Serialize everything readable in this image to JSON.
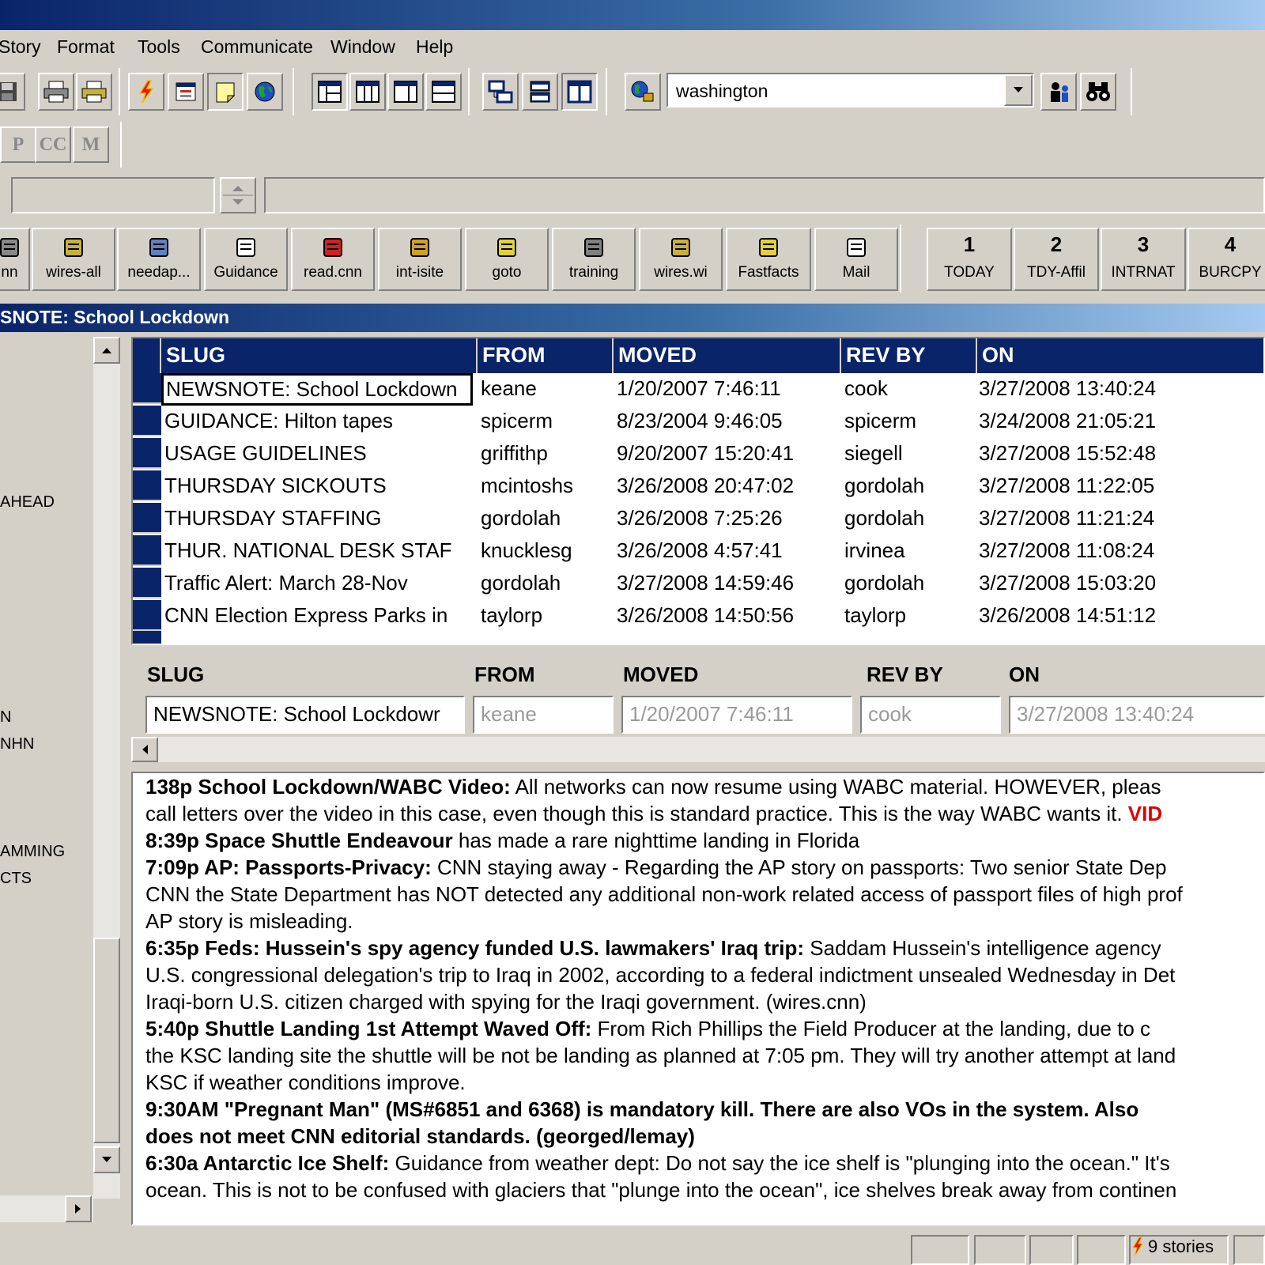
{
  "menu": [
    "Story",
    "Format",
    "Tools",
    "Communicate",
    "Window",
    "Help"
  ],
  "search": {
    "value": "washington"
  },
  "mode_buttons": [
    "P",
    "CC",
    "M"
  ],
  "quick_buttons": [
    {
      "label": "nn"
    },
    {
      "label": "wires-all"
    },
    {
      "label": "needap..."
    },
    {
      "label": "Guidance"
    },
    {
      "label": "read.cnn"
    },
    {
      "label": "int-isite"
    },
    {
      "label": "goto"
    },
    {
      "label": "training"
    },
    {
      "label": "wires.wi"
    },
    {
      "label": "Fastfacts"
    },
    {
      "label": "Mail"
    }
  ],
  "queue_buttons": [
    {
      "num": "1",
      "label": "TODAY"
    },
    {
      "num": "2",
      "label": "TDY-Affil"
    },
    {
      "num": "3",
      "label": "INTRNAT"
    },
    {
      "num": "4",
      "label": "BURCPY"
    }
  ],
  "panel_title": "SNOTE: School Lockdown",
  "left_items": [
    "AHEAD",
    "N",
    "NHN",
    "AMMING",
    "CTS"
  ],
  "grid": {
    "headers": [
      "SLUG",
      "FROM",
      "MOVED",
      "REV BY",
      "ON"
    ],
    "rows": [
      {
        "slug": "NEWSNOTE: School Lockdown",
        "from": "keane",
        "moved": "1/20/2007 7:46:11",
        "rev_by": "cook",
        "on": "3/27/2008 13:40:24"
      },
      {
        "slug": "GUIDANCE: Hilton tapes",
        "from": "spicerm",
        "moved": "8/23/2004 9:46:05",
        "rev_by": "spicerm",
        "on": "3/24/2008 21:05:21"
      },
      {
        "slug": "USAGE GUIDELINES",
        "from": "griffithp",
        "moved": "9/20/2007 15:20:41",
        "rev_by": "siegell",
        "on": "3/27/2008 15:52:48"
      },
      {
        "slug": "THURSDAY SICKOUTS",
        "from": "mcintoshs",
        "moved": "3/26/2008 20:47:02",
        "rev_by": "gordolah",
        "on": "3/27/2008 11:22:05"
      },
      {
        "slug": "THURSDAY STAFFING",
        "from": "gordolah",
        "moved": "3/26/2008 7:25:26",
        "rev_by": "gordolah",
        "on": "3/27/2008 11:21:24"
      },
      {
        "slug": "THUR. NATIONAL DESK STAF",
        "from": "knucklesg",
        "moved": "3/26/2008 4:57:41",
        "rev_by": "irvinea",
        "on": "3/27/2008 11:08:24"
      },
      {
        "slug": "Traffic Alert: March 28-Nov",
        "from": "gordolah",
        "moved": "3/27/2008 14:59:46",
        "rev_by": "gordolah",
        "on": "3/27/2008 15:03:20"
      },
      {
        "slug": "CNN Election Express Parks in",
        "from": "taylorp",
        "moved": "3/26/2008 14:50:56",
        "rev_by": "taylorp",
        "on": "3/26/2008 14:51:12"
      }
    ]
  },
  "detail": {
    "labels": [
      "SLUG",
      "FROM",
      "MOVED",
      "REV BY",
      "ON"
    ],
    "slug": "NEWSNOTE: School Lockdowr",
    "from": "keane",
    "moved": "1/20/2007 7:46:11",
    "rev_by": "cook",
    "on": "3/27/2008 13:40:24"
  },
  "body_lines": [
    {
      "b": "138p School Lockdown/WABC Video:",
      "t": " All networks can now resume using WABC material. HOWEVER, pleas"
    },
    {
      "b": "",
      "t": "call letters over the video in this case, even though this is standard practice. This is the way WABC wants it. ",
      "r": "VID"
    },
    {
      "b": "8:39p  Space Shuttle Endeavour",
      "t": " has made a rare nighttime landing in Florida"
    },
    {
      "b": "7:09p  AP: Passports-Privacy:",
      "t": "  CNN staying away - Regarding the AP story on passports: Two senior State Dep"
    },
    {
      "b": "",
      "t": "CNN the State Department has NOT detected any additional non-work related access of passport files of high prof"
    },
    {
      "b": "",
      "t": "AP story is misleading."
    },
    {
      "b": "6:35p   Feds: Hussein's spy agency funded U.S. lawmakers' Iraq trip:",
      "t": " Saddam Hussein's intelligence agency"
    },
    {
      "b": "",
      "t": "U.S. congressional delegation's trip to Iraq in 2002, according to a federal indictment unsealed Wednesday in Det"
    },
    {
      "b": "",
      "t": "Iraqi-born U.S. citizen charged with spying for the Iraqi government.  (wires.cnn)"
    },
    {
      "b": "5:40p   Shuttle Landing 1st Attempt Waved Off:",
      "t": "  From Rich Phillips the Field Producer at the landing, due to c"
    },
    {
      "b": "",
      "t": "the KSC landing site the shuttle will be not be landing as planned at 7:05 pm. They will try another attempt at land"
    },
    {
      "b": "",
      "t": "KSC if weather conditions improve."
    },
    {
      "b": "9:30AM  \"Pregnant Man\" (MS#6851 and 6368) is mandatory kill.  There are also VOs in the system.  Also",
      "t": ""
    },
    {
      "b": "does not meet CNN editorial standards.   (georged/lemay)",
      "t": ""
    },
    {
      "b": "6:30a Antarctic Ice Shelf:",
      "t": " Guidance from weather dept:  Do not say the ice shelf is \"plunging into the ocean.\" It's"
    },
    {
      "b": "",
      "t": "ocean. This is not to be confused with glaciers that \"plunge into the ocean\", ice shelves break away from continen"
    }
  ],
  "status": {
    "stories": "9 stories"
  }
}
